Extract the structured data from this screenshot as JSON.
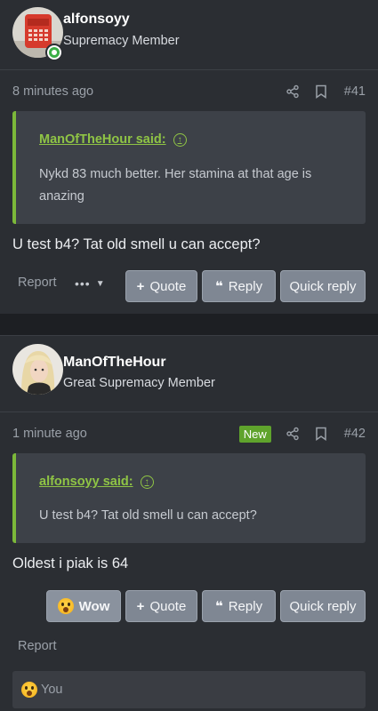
{
  "posts": [
    {
      "author": "alfonsoyy",
      "user_title": "Supremacy Member",
      "time": "8 minutes ago",
      "number": "#41",
      "quote": {
        "author_line": "ManOfTheHour said:",
        "text": "Nykd 83 much better. Her stamina at that age is anazing"
      },
      "message": "U test b4? Tat old smell u can accept?",
      "report_label": "Report",
      "buttons": {
        "quote": "Quote",
        "reply": "Reply",
        "quick_reply": "Quick reply"
      }
    },
    {
      "author": "ManOfTheHour",
      "user_title": "Great Supremacy Member",
      "time": "1 minute ago",
      "badge": "New",
      "number": "#42",
      "quote": {
        "author_line": "alfonsoyy said:",
        "text": "U test b4? Tat old smell u can accept?"
      },
      "message": "Oldest i piak is 64",
      "report_label": "Report",
      "buttons": {
        "wow": "Wow",
        "quote": "Quote",
        "reply": "Reply",
        "quick_reply": "Quick reply"
      },
      "reactions_text": "You"
    }
  ],
  "icons": {
    "share": "share-icon",
    "bookmark": "bookmark-icon",
    "online": "online-status-icon",
    "more": "more-options-icon",
    "plus": "plus-icon",
    "reply": "quote-marks-icon",
    "wow": "wow-emoji-icon",
    "up_arrow": "jump-to-quote-icon"
  },
  "colors": {
    "background": "#2b2e33",
    "accent_green": "#8fc445",
    "badge_green": "#5fa32c",
    "button": "#7f8793"
  }
}
